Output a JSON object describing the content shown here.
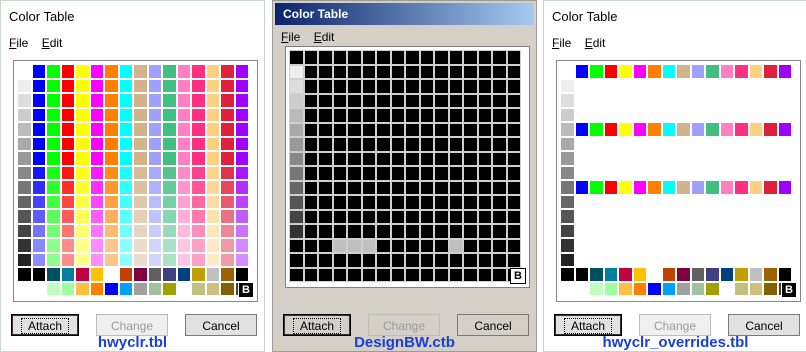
{
  "windows": [
    {
      "title": "Color Table",
      "menu": [
        {
          "label": "File",
          "u": "F",
          "rest": "ile"
        },
        {
          "label": "Edit",
          "u": "E",
          "rest": "dit"
        }
      ],
      "grid_badge": "B",
      "buttons": {
        "attach": "Attach",
        "change": "Change",
        "cancel": "Cancel"
      },
      "caption": "hwyclr.tbl"
    },
    {
      "title": "Color Table",
      "menu": [
        {
          "label": "File",
          "u": "F",
          "rest": "ile"
        },
        {
          "label": "Edit",
          "u": "E",
          "rest": "dit"
        }
      ],
      "grid_badge": "B",
      "buttons": {
        "attach": "Attach",
        "change": "Change",
        "cancel": "Cancel"
      },
      "caption": "DesignBW.ctb"
    },
    {
      "title": "Color Table",
      "menu": [
        {
          "label": "File",
          "u": "F",
          "rest": "ile"
        },
        {
          "label": "Edit",
          "u": "E",
          "rest": "dit"
        }
      ],
      "grid_badge": "B",
      "buttons": {
        "attach": "Attach",
        "change": "Change",
        "cancel": "Cancel"
      },
      "caption": "hwyclr_overrides.tbl"
    }
  ],
  "palette": {
    "hues": [
      "#0000ff",
      "#00ff00",
      "#ff0000",
      "#ffff00",
      "#ff00ff",
      "#ff8000",
      "#00ffff",
      "#d2b48c",
      "#a0a0ff",
      "#40c080",
      "#ff80c0",
      "#ff3080",
      "#ffd080",
      "#e0203c",
      "#a000ff"
    ],
    "row14": [
      "#000000",
      "#005060",
      "#0080a0",
      "#c00040",
      "#ffc000",
      "#ffffff",
      "#c04000",
      "#800040",
      "#606060",
      "#404080",
      "#004080",
      "#c0a000",
      "#c0c0c0",
      "#a06000",
      "#000000"
    ],
    "row15": [
      "#ffffff",
      "#c0ffc0",
      "#a0ffa0",
      "#ffc040",
      "#ff8000",
      "#0000ff",
      "#00a0ff",
      "#a0a0a0",
      "#a0c0a0",
      "#a0a000",
      "#ffffff",
      "#c0c080",
      "#d0c080",
      "#806000",
      "#404040"
    ]
  }
}
